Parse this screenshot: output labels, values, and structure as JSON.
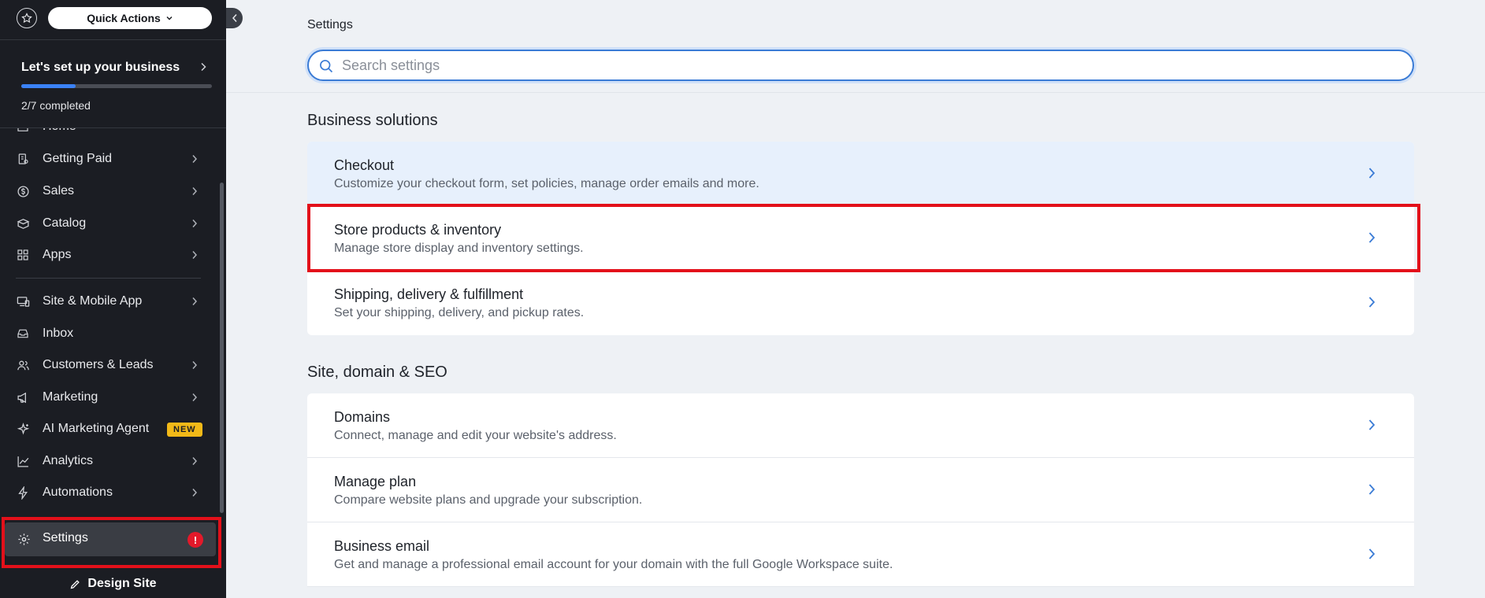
{
  "sidebar": {
    "quick_actions_label": "Quick Actions",
    "setup": {
      "title": "Let's set up your business",
      "progress": 0.2857,
      "progress_text": "2/7 completed"
    },
    "items": [
      {
        "label": "Home",
        "icon": "home-icon"
      },
      {
        "label": "Getting Paid",
        "icon": "getting-paid-icon"
      },
      {
        "label": "Sales",
        "icon": "dollar-circle-icon"
      },
      {
        "label": "Catalog",
        "icon": "catalog-icon"
      },
      {
        "label": "Apps",
        "icon": "apps-icon"
      },
      {
        "label": "Site & Mobile App",
        "icon": "devices-icon"
      },
      {
        "label": "Inbox",
        "icon": "inbox-icon"
      },
      {
        "label": "Customers & Leads",
        "icon": "customers-icon"
      },
      {
        "label": "Marketing",
        "icon": "megaphone-icon"
      },
      {
        "label": "AI Marketing Agent",
        "icon": "sparkle-icon",
        "badge": "NEW"
      },
      {
        "label": "Analytics",
        "icon": "analytics-icon"
      },
      {
        "label": "Automations",
        "icon": "lightning-icon"
      }
    ],
    "settings": {
      "label": "Settings",
      "alert": "!"
    },
    "design_site_label": "Design Site"
  },
  "header": {
    "breadcrumb": "Settings",
    "search_placeholder": "Search settings"
  },
  "sections": [
    {
      "title": "Business solutions",
      "rows": [
        {
          "title": "Checkout",
          "subtitle": "Customize your checkout form, set policies, manage order emails and more."
        },
        {
          "title": "Store products & inventory",
          "subtitle": "Manage store display and inventory settings."
        },
        {
          "title": "Shipping, delivery & fulfillment",
          "subtitle": "Set your shipping, delivery, and pickup rates."
        }
      ]
    },
    {
      "title": "Site, domain & SEO",
      "rows": [
        {
          "title": "Domains",
          "subtitle": "Connect, manage and edit your website's address."
        },
        {
          "title": "Manage plan",
          "subtitle": "Compare website plans and upgrade your subscription."
        },
        {
          "title": "Business email",
          "subtitle": "Get and manage a professional email account for your domain with the full Google Workspace suite."
        }
      ]
    }
  ],
  "colors": {
    "sidebar_bg": "#1b1d23",
    "accent": "#3b82f6",
    "highlight": "#e3101a",
    "new_badge": "#f2b918"
  }
}
